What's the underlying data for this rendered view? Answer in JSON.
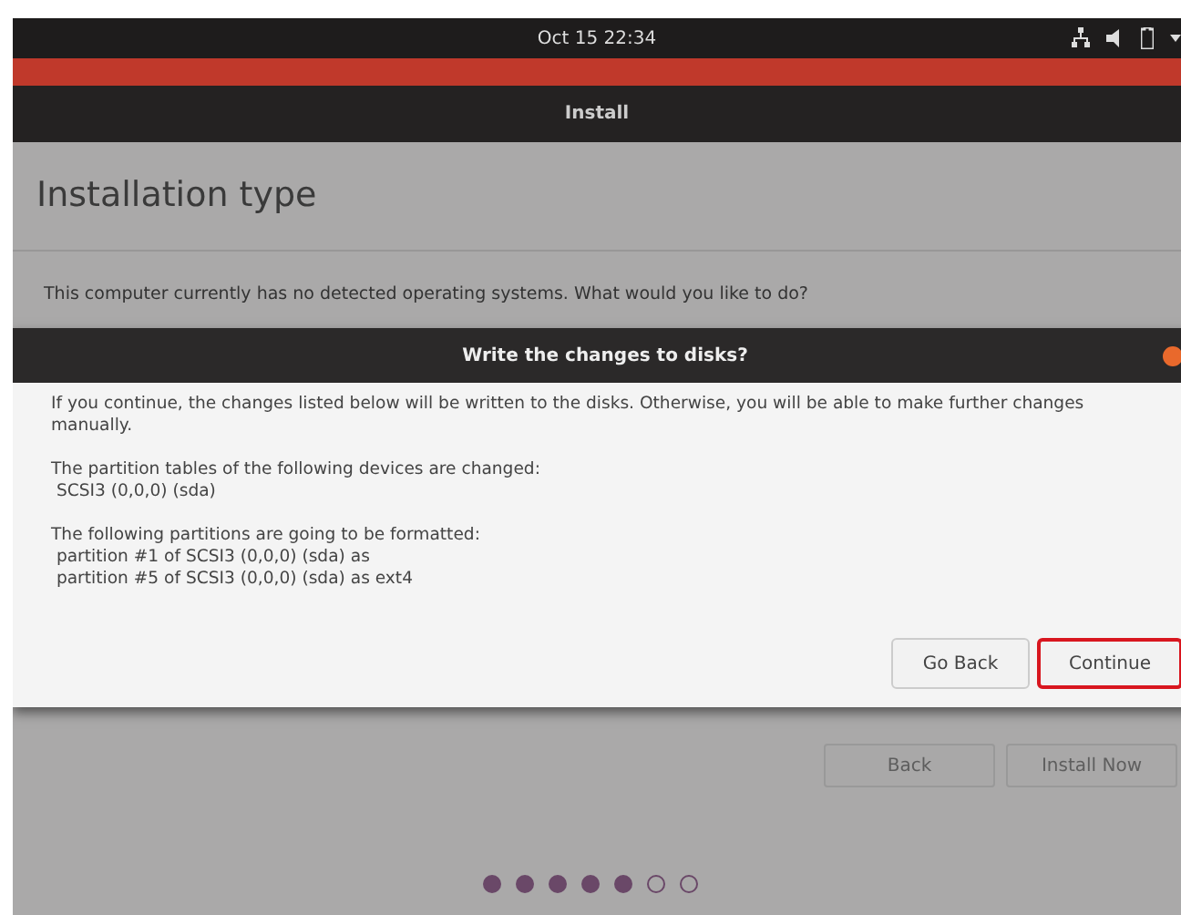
{
  "top_bar": {
    "clock": "Oct 15  22:34"
  },
  "window": {
    "title": "Install"
  },
  "page": {
    "heading": "Installation type",
    "question": "This computer currently has no detected operating systems. What would you like to do?"
  },
  "dialog": {
    "title": "Write the changes to disks?",
    "paragraphs": [
      [
        "If you continue, the changes listed below will be written to the disks. Otherwise, you will be able to make further changes manually."
      ],
      [
        "The partition tables of the following devices are changed:",
        " SCSI3 (0,0,0) (sda)"
      ],
      [
        "The following partitions are going to be formatted:",
        " partition #1 of SCSI3 (0,0,0) (sda) as",
        " partition #5 of SCSI3 (0,0,0) (sda) as ext4"
      ]
    ],
    "buttons": [
      {
        "label": "Go Back",
        "highlighted": false
      },
      {
        "label": "Continue",
        "highlighted": true
      }
    ]
  },
  "nav_buttons": [
    {
      "label": "Back"
    },
    {
      "label": "Install Now"
    }
  ],
  "steps": [
    {
      "filled": true
    },
    {
      "filled": true
    },
    {
      "filled": true
    },
    {
      "filled": true
    },
    {
      "filled": true
    },
    {
      "filled": false
    },
    {
      "filled": false
    }
  ]
}
